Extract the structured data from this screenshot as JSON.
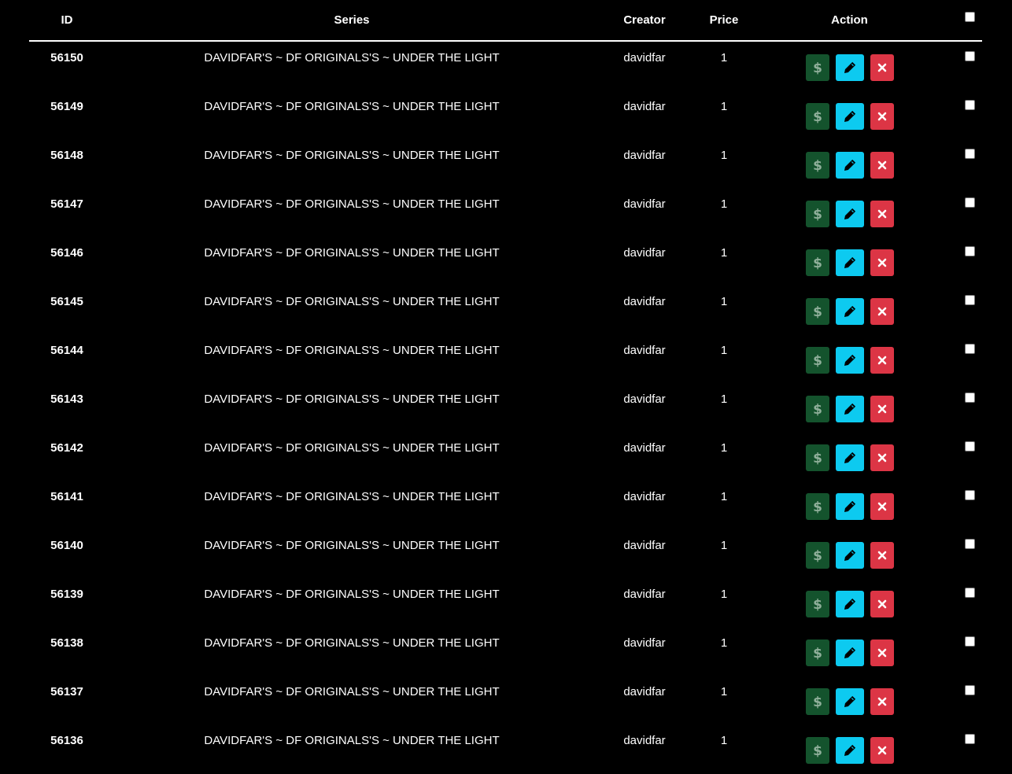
{
  "colors": {
    "background": "#000000",
    "text": "#ffffff",
    "sell_button": "#14532d",
    "sell_icon": "#8faf9a",
    "edit_button": "#0dcaf0",
    "edit_icon": "#000000",
    "delete_button": "#dc3545",
    "delete_icon": "#ffffff"
  },
  "table": {
    "headers": {
      "id": "ID",
      "series": "Series",
      "creator": "Creator",
      "price": "Price",
      "action": "Action"
    },
    "select_all_checked": false,
    "rows": [
      {
        "id": "56150",
        "series": "DAVIDFAR'S ~ DF ORIGINALS'S ~ UNDER THE LIGHT",
        "creator": "davidfar",
        "price": "1",
        "checked": false
      },
      {
        "id": "56149",
        "series": "DAVIDFAR'S ~ DF ORIGINALS'S ~ UNDER THE LIGHT",
        "creator": "davidfar",
        "price": "1",
        "checked": false
      },
      {
        "id": "56148",
        "series": "DAVIDFAR'S ~ DF ORIGINALS'S ~ UNDER THE LIGHT",
        "creator": "davidfar",
        "price": "1",
        "checked": false
      },
      {
        "id": "56147",
        "series": "DAVIDFAR'S ~ DF ORIGINALS'S ~ UNDER THE LIGHT",
        "creator": "davidfar",
        "price": "1",
        "checked": false
      },
      {
        "id": "56146",
        "series": "DAVIDFAR'S ~ DF ORIGINALS'S ~ UNDER THE LIGHT",
        "creator": "davidfar",
        "price": "1",
        "checked": false
      },
      {
        "id": "56145",
        "series": "DAVIDFAR'S ~ DF ORIGINALS'S ~ UNDER THE LIGHT",
        "creator": "davidfar",
        "price": "1",
        "checked": false
      },
      {
        "id": "56144",
        "series": "DAVIDFAR'S ~ DF ORIGINALS'S ~ UNDER THE LIGHT",
        "creator": "davidfar",
        "price": "1",
        "checked": false
      },
      {
        "id": "56143",
        "series": "DAVIDFAR'S ~ DF ORIGINALS'S ~ UNDER THE LIGHT",
        "creator": "davidfar",
        "price": "1",
        "checked": false
      },
      {
        "id": "56142",
        "series": "DAVIDFAR'S ~ DF ORIGINALS'S ~ UNDER THE LIGHT",
        "creator": "davidfar",
        "price": "1",
        "checked": false
      },
      {
        "id": "56141",
        "series": "DAVIDFAR'S ~ DF ORIGINALS'S ~ UNDER THE LIGHT",
        "creator": "davidfar",
        "price": "1",
        "checked": false
      },
      {
        "id": "56140",
        "series": "DAVIDFAR'S ~ DF ORIGINALS'S ~ UNDER THE LIGHT",
        "creator": "davidfar",
        "price": "1",
        "checked": false
      },
      {
        "id": "56139",
        "series": "DAVIDFAR'S ~ DF ORIGINALS'S ~ UNDER THE LIGHT",
        "creator": "davidfar",
        "price": "1",
        "checked": false
      },
      {
        "id": "56138",
        "series": "DAVIDFAR'S ~ DF ORIGINALS'S ~ UNDER THE LIGHT",
        "creator": "davidfar",
        "price": "1",
        "checked": false
      },
      {
        "id": "56137",
        "series": "DAVIDFAR'S ~ DF ORIGINALS'S ~ UNDER THE LIGHT",
        "creator": "davidfar",
        "price": "1",
        "checked": false
      },
      {
        "id": "56136",
        "series": "DAVIDFAR'S ~ DF ORIGINALS'S ~ UNDER THE LIGHT",
        "creator": "davidfar",
        "price": "1",
        "checked": false
      }
    ],
    "row_actions": [
      {
        "name": "sell-button",
        "icon": "dollar-icon"
      },
      {
        "name": "edit-button",
        "icon": "pencil-icon"
      },
      {
        "name": "delete-button",
        "icon": "close-icon"
      }
    ]
  }
}
